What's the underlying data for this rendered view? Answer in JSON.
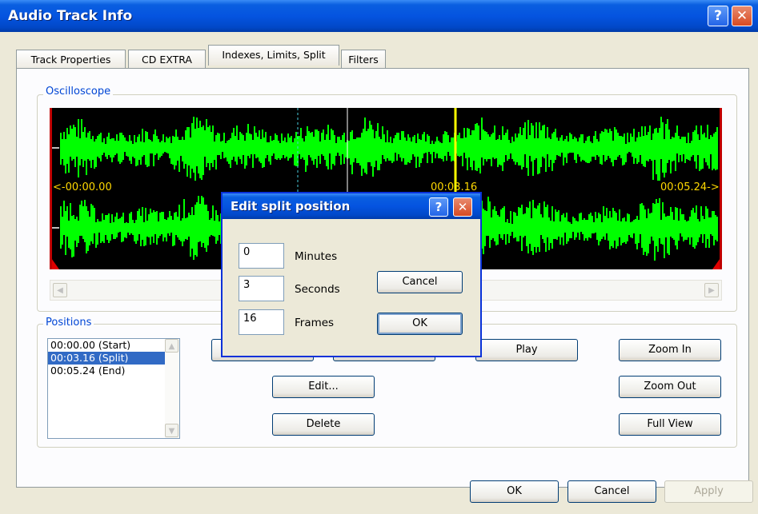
{
  "window": {
    "title": "Audio Track Info",
    "help_glyph": "?",
    "close_glyph": "✕"
  },
  "tabs": [
    "Track Properties",
    "CD EXTRA",
    "Indexes, Limits, Split",
    "Filters"
  ],
  "oscilloscope": {
    "label": "Oscilloscope",
    "time_start": "<-00:00.00",
    "time_split": "00:03.16",
    "time_end": "00:05.24->",
    "wave_color": "#00ff00",
    "marker_color": "#ffff00"
  },
  "positions": {
    "label": "Positions",
    "items": [
      "00:00.00 (Start)",
      "00:03.16 (Split)",
      "00:05.24 (End)"
    ],
    "selected_index": 1
  },
  "buttons": {
    "play": "Play",
    "edit": "Edit...",
    "delete": "Delete",
    "zoom_in": "Zoom In",
    "zoom_out": "Zoom Out",
    "full_view": "Full View"
  },
  "footer": {
    "ok": "OK",
    "cancel": "Cancel",
    "apply": "Apply"
  },
  "dialog": {
    "title": "Edit split position",
    "minutes_value": "0",
    "minutes_label": "Minutes",
    "seconds_value": "3",
    "seconds_label": "Seconds",
    "frames_value": "16",
    "frames_label": "Frames",
    "cancel": "Cancel",
    "ok": "OK"
  }
}
